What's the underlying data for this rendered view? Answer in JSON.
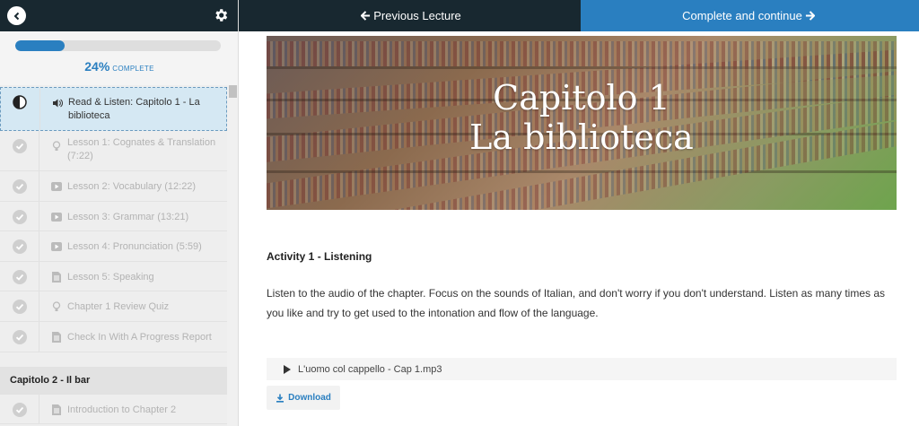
{
  "colors": {
    "dark": "#182830",
    "accent": "#2a7fc0",
    "active_bg": "#d5e8f3"
  },
  "nav": {
    "back_icon": "chevron-left-icon",
    "settings_icon": "gear-icon",
    "prev_label": "Previous Lecture",
    "next_label": "Complete and continue"
  },
  "progress": {
    "percent": 24,
    "percent_label": "24%",
    "label": "COMPLETE"
  },
  "sidebar": {
    "lectures": [
      {
        "label": "Read & Listen: Capitolo 1 - La biblioteca",
        "type_icon": "audio-icon",
        "status": "in-progress"
      },
      {
        "label": "Lesson 1: Cognates & Translation (7:22)",
        "type_icon": "lightbulb-icon",
        "status": "incomplete"
      },
      {
        "label": "Lesson 2: Vocabulary (12:22)",
        "type_icon": "video-icon",
        "status": "incomplete"
      },
      {
        "label": "Lesson 3: Grammar (13:21)",
        "type_icon": "video-icon",
        "status": "incomplete"
      },
      {
        "label": "Lesson 4: Pronunciation (5:59)",
        "type_icon": "video-icon",
        "status": "incomplete"
      },
      {
        "label": "Lesson 5: Speaking",
        "type_icon": "document-icon",
        "status": "incomplete"
      },
      {
        "label": "Chapter 1 Review Quiz",
        "type_icon": "lightbulb-icon",
        "status": "incomplete"
      },
      {
        "label": "Check In With A Progress Report",
        "type_icon": "document-icon",
        "status": "incomplete"
      }
    ],
    "section2": {
      "title": "Capitolo 2 - Il bar",
      "lectures": [
        {
          "label": "Introduction to Chapter 2",
          "type_icon": "document-icon",
          "status": "incomplete"
        }
      ]
    }
  },
  "main": {
    "banner": {
      "line1": "Capitolo 1",
      "line2": "La biblioteca"
    },
    "activity_title": "Activity 1 - Listening",
    "activity_text": "Listen to the audio of the chapter. Focus on the sounds of Italian, and don't worry if you don't understand. Listen as many times as you like and try to get used to the intonation and flow of the language.",
    "audio_file": "L'uomo col cappello - Cap 1.mp3",
    "download_label": "Download"
  }
}
